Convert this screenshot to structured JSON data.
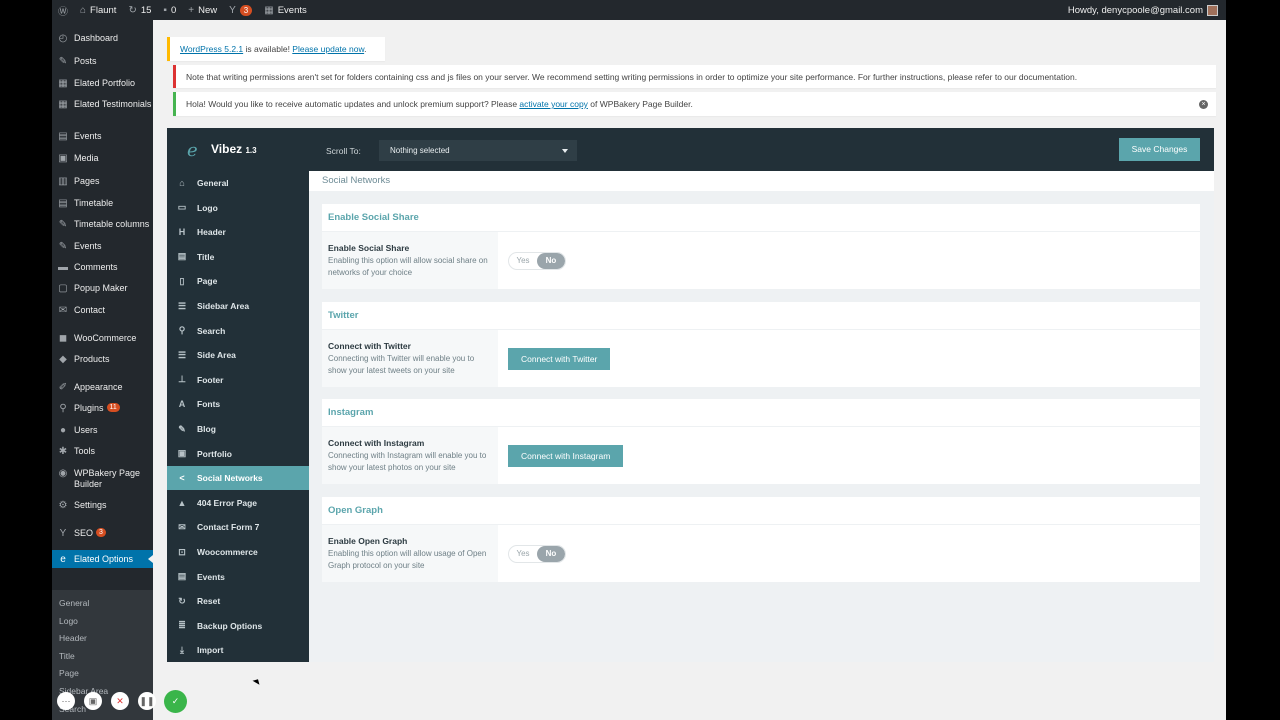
{
  "adminbar": {
    "site": "Flaunt",
    "updates": "15",
    "comments": "0",
    "new": "New",
    "yoast_badge": "3",
    "events": "Events",
    "howdy": "Howdy, denycpoole@gmail.com"
  },
  "wpmenu": {
    "items": [
      {
        "label": "Dashboard",
        "icon": "dashboard-icon"
      },
      {
        "label": "Posts",
        "icon": "pin-icon"
      },
      {
        "label": "Elated Portfolio",
        "icon": "grid-icon"
      },
      {
        "label": "Elated Testimonials",
        "icon": "grid-icon"
      },
      {
        "label": "Events",
        "icon": "calendar-icon"
      },
      {
        "label": "Media",
        "icon": "media-icon"
      },
      {
        "label": "Pages",
        "icon": "pages-icon"
      },
      {
        "label": "Timetable",
        "icon": "calendar-icon"
      },
      {
        "label": "Timetable columns",
        "icon": "pin-icon"
      },
      {
        "label": "Events",
        "icon": "pin-icon"
      },
      {
        "label": "Comments",
        "icon": "comment-icon"
      },
      {
        "label": "Popup Maker",
        "icon": "popup-icon"
      },
      {
        "label": "Contact",
        "icon": "mail-icon"
      },
      {
        "label": "WooCommerce",
        "icon": "woo-icon"
      },
      {
        "label": "Products",
        "icon": "box-icon"
      },
      {
        "label": "Appearance",
        "icon": "brush-icon"
      },
      {
        "label": "Plugins",
        "icon": "plug-icon",
        "badge": "11"
      },
      {
        "label": "Users",
        "icon": "user-icon"
      },
      {
        "label": "Tools",
        "icon": "wrench-icon"
      },
      {
        "label": "WPBakery Page Builder",
        "icon": "wpb-icon"
      },
      {
        "label": "Settings",
        "icon": "settings-icon"
      },
      {
        "label": "SEO",
        "icon": "yoast-icon",
        "badge": "3"
      },
      {
        "label": "Elated Options",
        "icon": "elated-icon"
      }
    ],
    "subitems": [
      "General",
      "Logo",
      "Header",
      "Title",
      "Page",
      "Sidebar Area",
      "Search"
    ]
  },
  "notices": {
    "update_link": "WordPress 5.2.1",
    "update_mid": " is available! ",
    "update_link2": "Please update now",
    "update_end": ".",
    "permissions": "Note that writing permissions aren't set for folders containing css and js files on your server. We recommend setting writing permissions in order to optimize your site performance. For further instructions, please refer to our documentation.",
    "hola_start": "Hola! Would you like to receive automatic updates and unlock premium support? Please ",
    "hola_link": "activate your copy",
    "hola_end": " of WPBakery Page Builder."
  },
  "panel": {
    "logo": "Vibez",
    "version": "1.3",
    "scroll_to_label": "Scroll To:",
    "scroll_to_value": "Nothing selected",
    "save_label": "Save Changes",
    "nav": [
      {
        "label": "General",
        "icon": "bank-icon"
      },
      {
        "label": "Logo",
        "icon": "logo-icon"
      },
      {
        "label": "Header",
        "icon": "header-icon"
      },
      {
        "label": "Title",
        "icon": "title-icon"
      },
      {
        "label": "Page",
        "icon": "page-icon"
      },
      {
        "label": "Sidebar Area",
        "icon": "sidebar-icon"
      },
      {
        "label": "Search",
        "icon": "search-icon"
      },
      {
        "label": "Side Area",
        "icon": "sidearea-icon"
      },
      {
        "label": "Footer",
        "icon": "footer-icon"
      },
      {
        "label": "Fonts",
        "icon": "font-icon"
      },
      {
        "label": "Blog",
        "icon": "blog-icon"
      },
      {
        "label": "Portfolio",
        "icon": "portfolio-icon"
      },
      {
        "label": "Social Networks",
        "icon": "share-icon"
      },
      {
        "label": "404 Error Page",
        "icon": "warning-icon"
      },
      {
        "label": "Contact Form 7",
        "icon": "mail-icon"
      },
      {
        "label": "Woocommerce",
        "icon": "cart-icon"
      },
      {
        "label": "Events",
        "icon": "calendar-icon"
      },
      {
        "label": "Reset",
        "icon": "reset-icon"
      },
      {
        "label": "Backup Options",
        "icon": "database-icon"
      },
      {
        "label": "Import",
        "icon": "download-icon"
      }
    ],
    "active": "Social Networks",
    "content_title": "Social Networks",
    "sections": [
      {
        "title": "Enable Social Share",
        "label": "Enable Social Share",
        "desc": "Enabling this option will allow social share on networks of your choice",
        "yes": "Yes",
        "no": "No",
        "value": "No"
      },
      {
        "title": "Twitter",
        "label": "Connect with Twitter",
        "desc": "Connecting with Twitter will enable you to show your latest tweets on your site",
        "button": "Connect with Twitter"
      },
      {
        "title": "Instagram",
        "label": "Connect with Instagram",
        "desc": "Connecting with Instagram will enable you to show your latest photos on your site",
        "button": "Connect with Instagram"
      },
      {
        "title": "Open Graph",
        "label": "Enable Open Graph",
        "desc": "Enabling this option will allow usage of Open Graph protocol on your site",
        "yes": "Yes",
        "no": "No",
        "value": "No"
      }
    ]
  },
  "colors": {
    "accent": "#5ba5ac",
    "panel_dark": "#223038",
    "wp_blue": "#0073aa"
  }
}
